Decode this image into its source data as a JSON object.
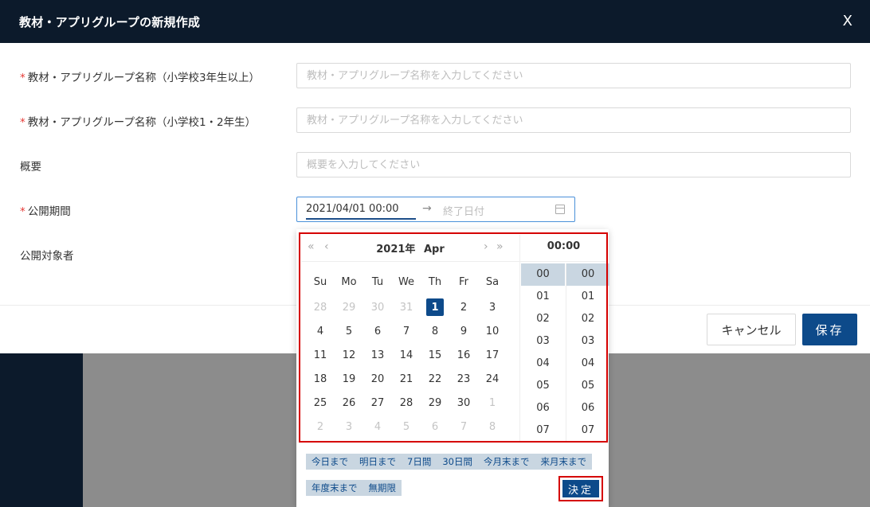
{
  "modal": {
    "title": "教材・アプリグループの新規作成",
    "close_label": "X"
  },
  "form": {
    "name_upper": {
      "required_mark": "*",
      "label": "教材・アプリグループ名称（小学校3年生以上）",
      "placeholder": "教材・アプリグループ名称を入力してください",
      "value": ""
    },
    "name_lower": {
      "required_mark": "*",
      "label": "教材・アプリグループ名称（小学校1・2年生）",
      "placeholder": "教材・アプリグループ名称を入力してください",
      "value": ""
    },
    "overview": {
      "label": "概要",
      "placeholder": "概要を入力してください",
      "value": ""
    },
    "period": {
      "required_mark": "*",
      "label": "公開期間",
      "start": "2021/04/01 00:00",
      "arrow": "→",
      "end_placeholder": "終了日付"
    },
    "target": {
      "label": "公開対象者"
    }
  },
  "footer": {
    "cancel_label": "キャンセル",
    "save_label": "保存"
  },
  "picker": {
    "nav_prev_year": "«",
    "nav_prev_month": "‹",
    "nav_next_month": "›",
    "nav_next_year": "»",
    "year_label": "2021年",
    "month_label": "Apr",
    "weekdays": [
      "Su",
      "Mo",
      "Tu",
      "We",
      "Th",
      "Fr",
      "Sa"
    ],
    "days": [
      {
        "d": "28",
        "muted": true
      },
      {
        "d": "29",
        "muted": true
      },
      {
        "d": "30",
        "muted": true
      },
      {
        "d": "31",
        "muted": true
      },
      {
        "d": "1",
        "selected": true
      },
      {
        "d": "2"
      },
      {
        "d": "3"
      },
      {
        "d": "4"
      },
      {
        "d": "5"
      },
      {
        "d": "6"
      },
      {
        "d": "7"
      },
      {
        "d": "8"
      },
      {
        "d": "9"
      },
      {
        "d": "10"
      },
      {
        "d": "11"
      },
      {
        "d": "12"
      },
      {
        "d": "13"
      },
      {
        "d": "14"
      },
      {
        "d": "15"
      },
      {
        "d": "16"
      },
      {
        "d": "17"
      },
      {
        "d": "18"
      },
      {
        "d": "19"
      },
      {
        "d": "20"
      },
      {
        "d": "21"
      },
      {
        "d": "22"
      },
      {
        "d": "23"
      },
      {
        "d": "24"
      },
      {
        "d": "25"
      },
      {
        "d": "26"
      },
      {
        "d": "27"
      },
      {
        "d": "28"
      },
      {
        "d": "29"
      },
      {
        "d": "30"
      },
      {
        "d": "1",
        "muted": true
      },
      {
        "d": "2",
        "muted": true
      },
      {
        "d": "3",
        "muted": true
      },
      {
        "d": "4",
        "muted": true
      },
      {
        "d": "5",
        "muted": true
      },
      {
        "d": "6",
        "muted": true
      },
      {
        "d": "7",
        "muted": true
      },
      {
        "d": "8",
        "muted": true
      }
    ],
    "time_header": "00:00",
    "hours": [
      "00",
      "01",
      "02",
      "03",
      "04",
      "05",
      "06",
      "07"
    ],
    "minutes": [
      "00",
      "01",
      "02",
      "03",
      "04",
      "05",
      "06",
      "07"
    ],
    "selected_hour": "00",
    "selected_minute": "00",
    "presets_row1": [
      "今日まで",
      "明日まで",
      "7日間",
      "30日間",
      "今月末まで",
      "来月末まで"
    ],
    "presets_row2": [
      "年度末まで",
      "無期限"
    ],
    "confirm_label": "決定"
  },
  "colors": {
    "header_bg": "#0c1a2b",
    "primary": "#0d4a8a",
    "highlight": "#d50000",
    "preset_bg": "#c9d6e1"
  }
}
